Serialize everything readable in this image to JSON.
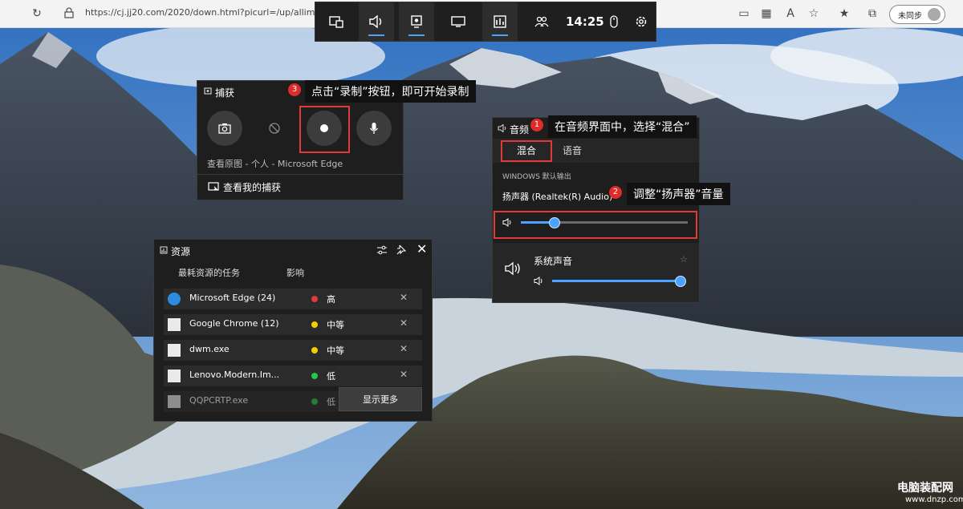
{
  "browser": {
    "url": "https://cj.jj20.com/2020/down.html?picurl=/up/allimg/11",
    "sync_label": "未同步"
  },
  "gamebar": {
    "time": "14:25",
    "widgets": [
      "widget-menu-icon",
      "audio-icon",
      "capture-icon",
      "performance-icon",
      "resources-icon",
      "xbox-social-icon"
    ]
  },
  "capture": {
    "title": "捕获",
    "hint": "查看原图 - 个人 - Microsoft Edge",
    "link": "查看我的捕获",
    "callout": "点击“录制”按钮，即可开始录制",
    "badge": "3"
  },
  "audio": {
    "title": "音频",
    "tabs": [
      "混合",
      "语音"
    ],
    "output_header": "WINDOWS 默认输出",
    "device": "扬声器 (Realtek(R) Audio)",
    "device_volume": 0.2,
    "app_name": "系统声音",
    "app_volume": 0.98,
    "callout1": "在音频界面中，选择“混合”",
    "callout2": "调整“扬声器”音量",
    "badge1": "1",
    "badge2": "2"
  },
  "resources": {
    "title": "资源",
    "col_task": "最耗资源的任务",
    "col_impact": "影响",
    "rows": [
      {
        "name": "Microsoft Edge (24)",
        "impact": "高",
        "color": "#e23a3a"
      },
      {
        "name": "Google Chrome (12)",
        "impact": "中等",
        "color": "#f0d000"
      },
      {
        "name": "dwm.exe",
        "impact": "中等",
        "color": "#f0d000"
      },
      {
        "name": "Lenovo.Modern.Im...",
        "impact": "低",
        "color": "#22c94a"
      },
      {
        "name": "QQPCRTP.exe",
        "impact": "低",
        "color": "#22c94a"
      }
    ],
    "show_more": "显示更多"
  },
  "watermark": {
    "line1": "电脑装配网",
    "line2": "www.dnzp.com"
  }
}
